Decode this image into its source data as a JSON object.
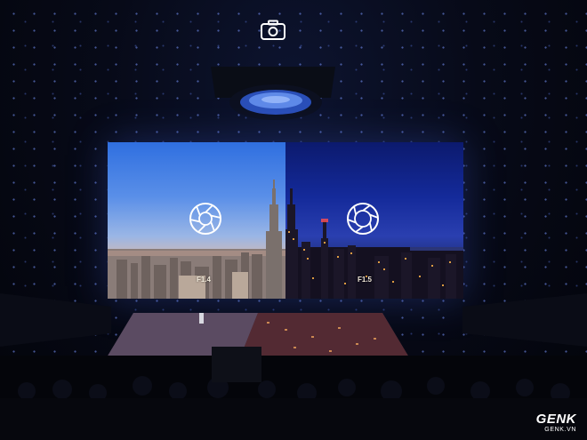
{
  "scene": {
    "description_icons": [
      "camera-icon",
      "aperture-icon"
    ],
    "screen": {
      "left_label": "F1.4",
      "right_label": "F1.5"
    },
    "watermark": {
      "brand": "GENK",
      "site": "GENK.VN"
    }
  },
  "colors": {
    "day_sky": "#3f7ae2",
    "night_sky": "#142a9a",
    "background": "#05070f"
  }
}
